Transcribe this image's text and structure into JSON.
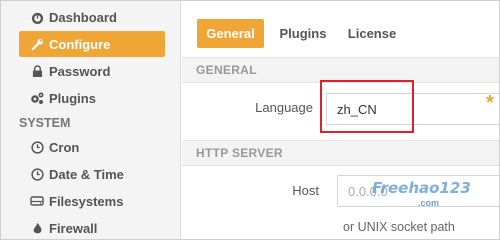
{
  "sidebar": {
    "items": [
      {
        "label": "Dashboard",
        "icon": "dashboard-icon"
      },
      {
        "label": "Configure",
        "icon": "wrench-icon",
        "active": true
      },
      {
        "label": "Password",
        "icon": "lock-icon"
      },
      {
        "label": "Plugins",
        "icon": "gears-icon"
      }
    ],
    "system_heading": "SYSTEM",
    "system_items": [
      {
        "label": "Cron",
        "icon": "clock-icon"
      },
      {
        "label": "Date & Time",
        "icon": "clock-icon"
      },
      {
        "label": "Filesystems",
        "icon": "drive-icon"
      },
      {
        "label": "Firewall",
        "icon": "fire-icon"
      }
    ]
  },
  "tabs": [
    {
      "label": "General",
      "active": true
    },
    {
      "label": "Plugins"
    },
    {
      "label": "License"
    }
  ],
  "general": {
    "heading": "GENERAL",
    "language_label": "Language",
    "language_value": "zh_CN",
    "required_mark": "*"
  },
  "http_server": {
    "heading": "HTTP SERVER",
    "host_label": "Host",
    "host_placeholder": "0.0.0.0",
    "host_help": "or UNIX socket path"
  },
  "watermark": {
    "text": "Freehao123",
    "sub": ".com"
  },
  "colors": {
    "accent": "#f0a537",
    "highlight_box": "#d9232a"
  }
}
